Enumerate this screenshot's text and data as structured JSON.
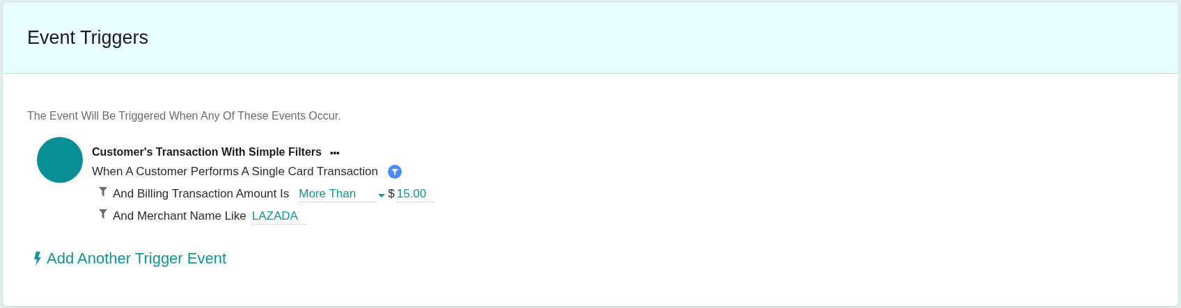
{
  "panel": {
    "title": "Event Triggers"
  },
  "description": "The Event Will Be Triggered When Any Of These Events Occur.",
  "triggers": [
    {
      "title": "Customer's Transaction With Simple Filters",
      "menu": "•••",
      "description": "When A Customer Performs A Single Card Transaction",
      "filters": [
        {
          "kind": "comparison",
          "label": "And Billing Transaction Amount Is",
          "operator": "More Than",
          "currency": "$",
          "value": "15.00"
        },
        {
          "kind": "text",
          "label": "And Merchant Name Like",
          "value": "LAZADA"
        }
      ]
    }
  ],
  "add_link": "Add Another Trigger Event"
}
